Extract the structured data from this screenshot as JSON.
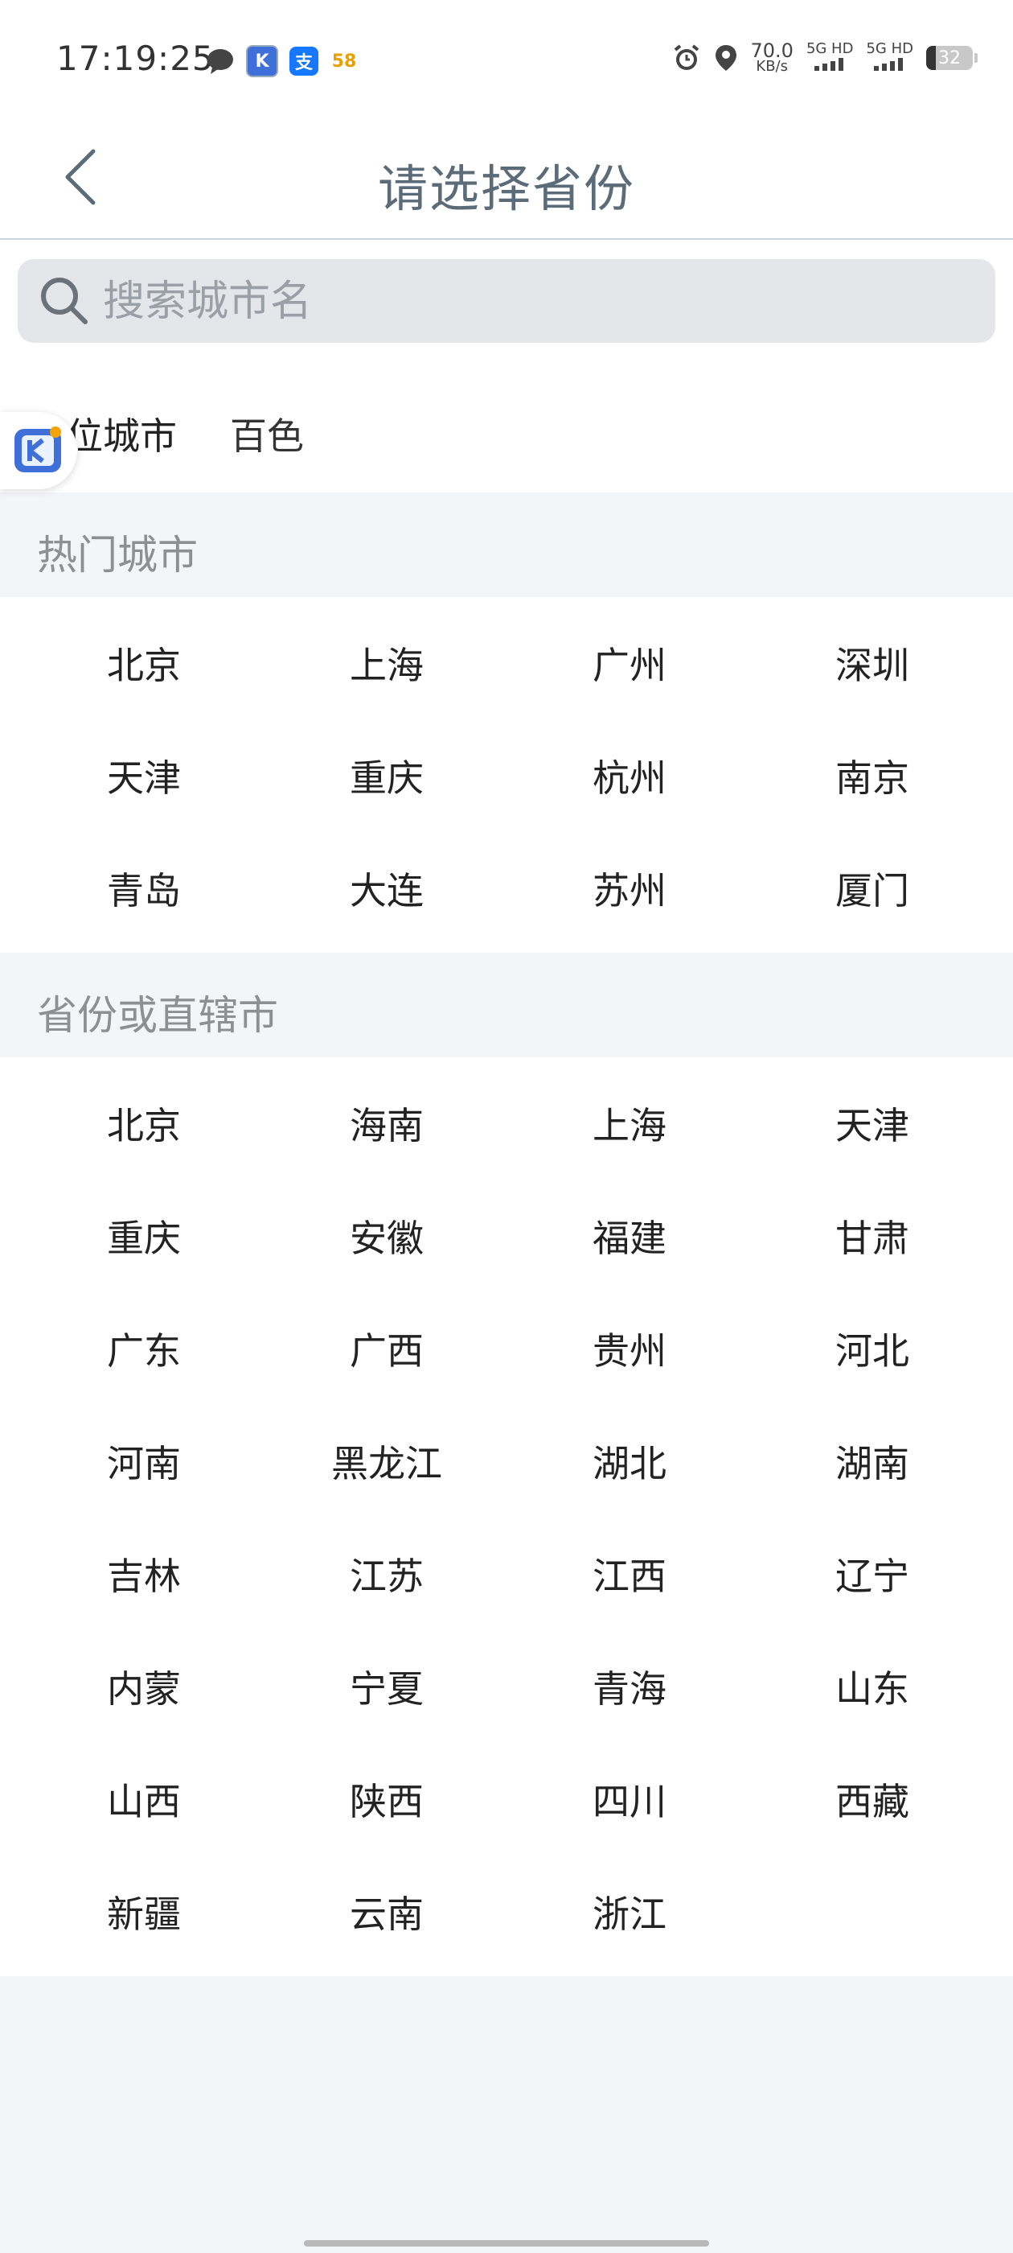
{
  "status_bar": {
    "time": "17:19:25",
    "app_icons": [
      "chat-bubble-icon",
      "k-app-icon",
      "alipay-icon",
      "58-icon"
    ],
    "app_58_label": "58",
    "alipay_label": "支",
    "k_label": "K",
    "net_speed_value": "70.0",
    "net_speed_unit": "KB/s",
    "signal_1": "5G HD",
    "signal_2": "5G HD",
    "battery": "32"
  },
  "header": {
    "title": "请选择省份"
  },
  "search": {
    "placeholder": "搜索城市名"
  },
  "located": {
    "label": "定位城市",
    "city": "百色"
  },
  "hot_cities": {
    "title": "热门城市",
    "items": [
      "北京",
      "上海",
      "广州",
      "深圳",
      "天津",
      "重庆",
      "杭州",
      "南京",
      "青岛",
      "大连",
      "苏州",
      "厦门"
    ]
  },
  "provinces": {
    "title": "省份或直辖市",
    "items": [
      "北京",
      "海南",
      "上海",
      "天津",
      "重庆",
      "安徽",
      "福建",
      "甘肃",
      "广东",
      "广西",
      "贵州",
      "河北",
      "河南",
      "黑龙江",
      "湖北",
      "湖南",
      "吉林",
      "江苏",
      "江西",
      "辽宁",
      "内蒙",
      "宁夏",
      "青海",
      "山东",
      "山西",
      "陕西",
      "四川",
      "西藏",
      "新疆",
      "云南",
      "浙江"
    ]
  },
  "colors": {
    "title": "#5b6b78",
    "section_text": "#8d8f93",
    "background": "#f4f5f7",
    "search_bg": "#e4e6ea"
  }
}
